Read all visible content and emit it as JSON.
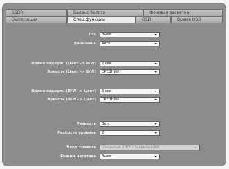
{
  "tabs": {
    "row1": [
      {
        "label": "SSDR"
      },
      {
        "label": "Баланс белого"
      },
      {
        "label": "Фоновая засветка"
      }
    ],
    "row2": [
      {
        "label": "Экспозиция"
      },
      {
        "label": "Спец.функции"
      },
      {
        "label": "OSD"
      },
      {
        "label": "Время OSD"
      }
    ]
  },
  "settings": {
    "dis": {
      "label": "DIS",
      "value": "Выкл."
    },
    "day_night": {
      "label": "День/ночь",
      "value": "Авто"
    },
    "delay_color_bw": {
      "label": "Время задерж. (Цвет -> B/W)",
      "value": "2 сек"
    },
    "bright_color_bw": {
      "label": "Яркость (Цвет -> B/W)",
      "value": "СРЕДНИЙ"
    },
    "delay_bw_color": {
      "label": "Время задерж. (B/W -> Цвет)",
      "value": "3 сек"
    },
    "bright_bw_color": {
      "label": "Яркость (B/W -> Цвет)",
      "value": "СРЕДНИЙ"
    },
    "sharpness": {
      "label": "Резкость",
      "value": "Вкл."
    },
    "sharpness_level": {
      "label": "Резкость уровень",
      "value": "2"
    },
    "alarm_input": {
      "label": "Вход тревоги",
      "value": "Открытый:ЦВЕТ / Закрытый:BW"
    },
    "negative_mode": {
      "label": "Режим негатива",
      "value": "Выкл."
    }
  }
}
